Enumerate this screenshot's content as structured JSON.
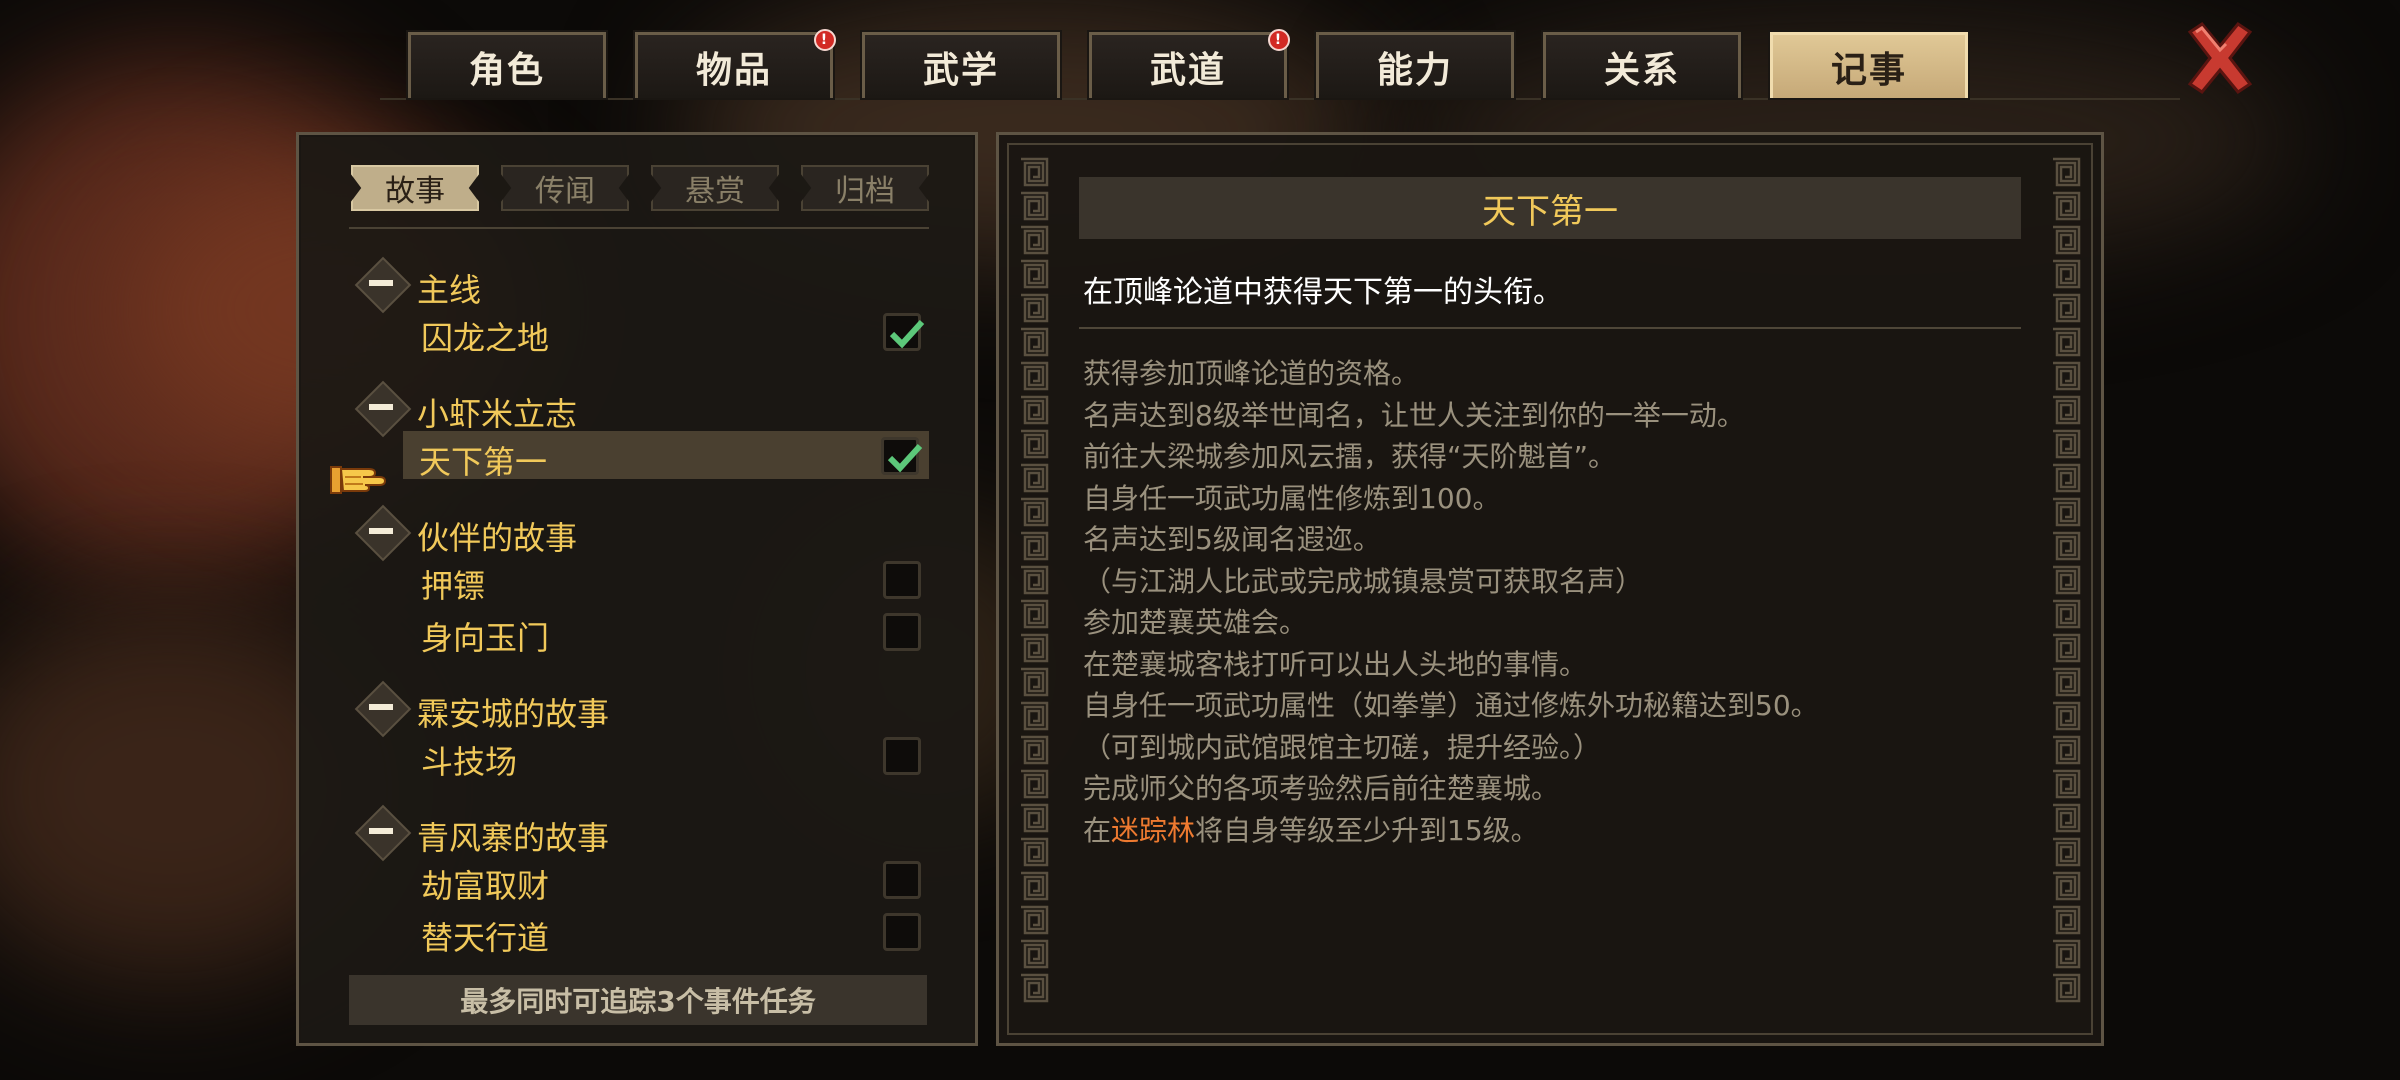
{
  "tabs": [
    {
      "label": "角色",
      "badge": false,
      "active": false
    },
    {
      "label": "物品",
      "badge": true,
      "active": false
    },
    {
      "label": "武学",
      "badge": false,
      "active": false
    },
    {
      "label": "武道",
      "badge": true,
      "active": false
    },
    {
      "label": "能力",
      "badge": false,
      "active": false
    },
    {
      "label": "关系",
      "badge": false,
      "active": false
    },
    {
      "label": "记事",
      "badge": false,
      "active": true
    }
  ],
  "badge_glyph": "!",
  "subtabs": [
    {
      "label": "故事",
      "active": true
    },
    {
      "label": "传闻",
      "active": false
    },
    {
      "label": "悬赏",
      "active": false
    },
    {
      "label": "归档",
      "active": false
    }
  ],
  "quest_groups": [
    {
      "title": "主线",
      "quests": [
        {
          "title": "囚龙之地",
          "done": true,
          "selected": false
        }
      ]
    },
    {
      "title": "小虾米立志",
      "quests": [
        {
          "title": "天下第一",
          "done": true,
          "selected": true
        }
      ]
    },
    {
      "title": "伙伴的故事",
      "quests": [
        {
          "title": "押镖",
          "done": false,
          "selected": false
        },
        {
          "title": "身向玉门",
          "done": false,
          "selected": false
        }
      ]
    },
    {
      "title": "霖安城的故事",
      "quests": [
        {
          "title": "斗技场",
          "done": false,
          "selected": false
        }
      ]
    },
    {
      "title": "青风寨的故事",
      "quests": [
        {
          "title": "劫富取财",
          "done": false,
          "selected": false
        },
        {
          "title": "替天行道",
          "done": false,
          "selected": false
        }
      ]
    }
  ],
  "track_note": "最多同时可追踪3个事件任务",
  "detail": {
    "title": "天下第一",
    "summary": "在顶峰论道中获得天下第一的头衔。",
    "steps": [
      "获得参加顶峰论道的资格。",
      "名声达到8级举世闻名，让世人关注到你的一举一动。",
      "前往大梁城参加风云擂，获得“天阶魁首”。",
      "自身任一项武功属性修炼到100。",
      "名声达到5级闻名遐迩。",
      "（与江湖人比武或完成城镇悬赏可获取名声）",
      "参加楚襄英雄会。",
      "在楚襄城客栈打听可以出人头地的事情。",
      "自身任一项武功属性（如拳掌）通过修炼外功秘籍达到50。",
      "（可到城内武馆跟馆主切磋，提升经验。）",
      "完成师父的各项考验然后前往楚襄城。"
    ],
    "last_step": {
      "prefix": "在",
      "highlight": "迷踪林",
      "suffix": "将自身等级至少升到15级。"
    }
  },
  "colors": {
    "accent_gold": "#f1c95a",
    "highlight_orange": "#ee7a30",
    "check_green": "#5cc87a",
    "close_red": "#c83a30"
  }
}
